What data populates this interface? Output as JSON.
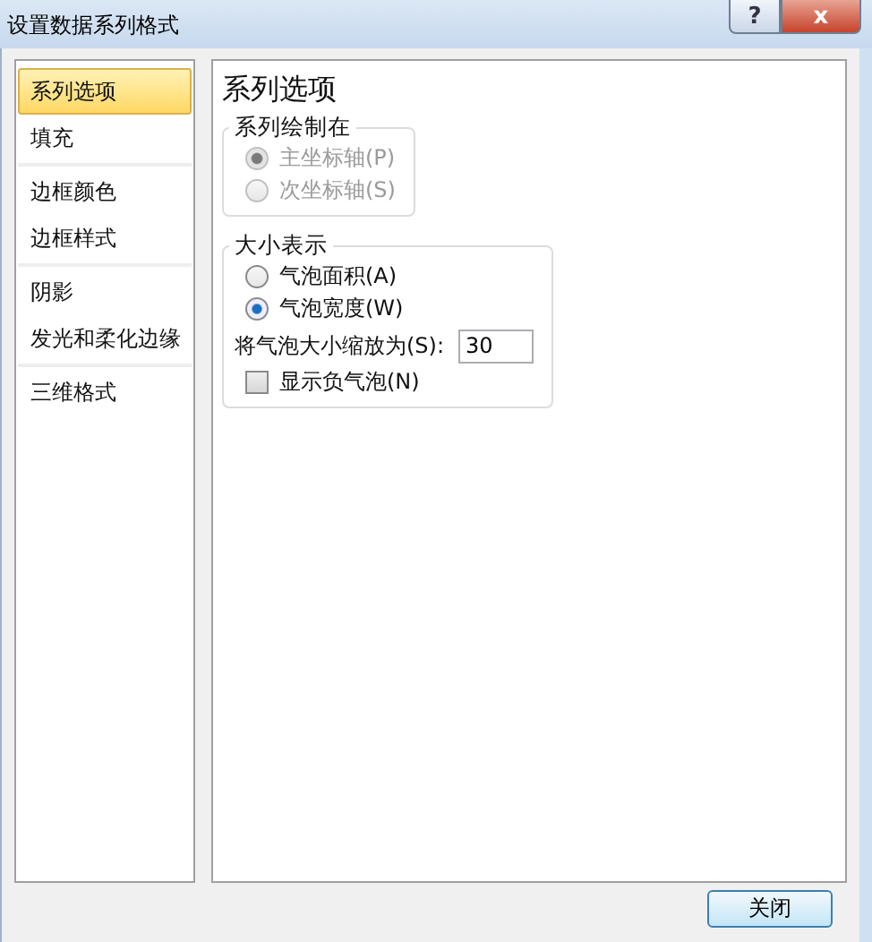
{
  "window": {
    "title": "设置数据系列格式",
    "help_button": "?",
    "close_button": "x"
  },
  "sidebar": {
    "groups": [
      {
        "items": [
          {
            "label": "系列选项",
            "selected": true
          },
          {
            "label": "填充",
            "selected": false
          }
        ]
      },
      {
        "items": [
          {
            "label": "边框颜色",
            "selected": false
          },
          {
            "label": "边框样式",
            "selected": false
          }
        ]
      },
      {
        "items": [
          {
            "label": "阴影",
            "selected": false
          },
          {
            "label": "发光和柔化边缘",
            "selected": false
          }
        ]
      },
      {
        "items": [
          {
            "label": "三维格式",
            "selected": false
          }
        ]
      }
    ]
  },
  "panel": {
    "heading": "系列选项",
    "plot_on": {
      "legend": "系列绘制在",
      "options": [
        {
          "label": "主坐标轴(P)",
          "selected": true,
          "disabled": true
        },
        {
          "label": "次坐标轴(S)",
          "selected": false,
          "disabled": true
        }
      ]
    },
    "size_represents": {
      "legend": "大小表示",
      "options": [
        {
          "label": "气泡面积(A)",
          "selected": false,
          "disabled": false
        },
        {
          "label": "气泡宽度(W)",
          "selected": true,
          "disabled": false
        }
      ],
      "scale": {
        "label": "将气泡大小缩放为(S):",
        "value": "30"
      },
      "negative": {
        "label": "显示负气泡(N)",
        "checked": false
      }
    }
  },
  "footer": {
    "close": "关闭"
  }
}
